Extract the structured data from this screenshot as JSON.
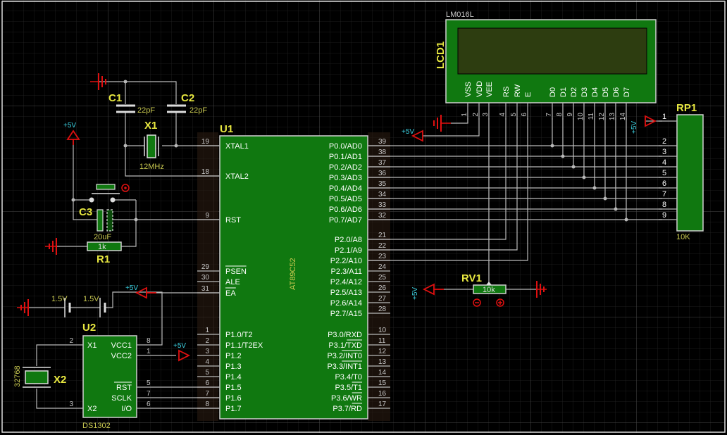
{
  "colors": {
    "background": "#000000",
    "grid": "#3a3a3a",
    "component_fill": "#107810",
    "wire": "#b9b9b9",
    "refdes": "#e8e840",
    "power_label": "#3bd0e0",
    "power_symbol": "#e01010"
  },
  "u1": {
    "ref": "U1",
    "part": "AT89C52",
    "left_pins": [
      {
        "num": "19",
        "name": "XTAL1"
      },
      {
        "num": "18",
        "name": "XTAL2"
      },
      {
        "num": "9",
        "name": "RST"
      },
      {
        "num": "29",
        "name": "PSEN"
      },
      {
        "num": "30",
        "name": "ALE"
      },
      {
        "num": "31",
        "name": "EA"
      },
      {
        "num": "1",
        "name": "P1.0/T2"
      },
      {
        "num": "2",
        "name": "P1.1/T2EX"
      },
      {
        "num": "3",
        "name": "P1.2"
      },
      {
        "num": "4",
        "name": "P1.3"
      },
      {
        "num": "5",
        "name": "P1.4"
      },
      {
        "num": "6",
        "name": "P1.5"
      },
      {
        "num": "7",
        "name": "P1.6"
      },
      {
        "num": "8",
        "name": "P1.7"
      }
    ],
    "right_pins": [
      {
        "num": "39",
        "name": "P0.0/AD0"
      },
      {
        "num": "38",
        "name": "P0.1/AD1"
      },
      {
        "num": "37",
        "name": "P0.2/AD2"
      },
      {
        "num": "36",
        "name": "P0.3/AD3"
      },
      {
        "num": "35",
        "name": "P0.4/AD4"
      },
      {
        "num": "34",
        "name": "P0.5/AD5"
      },
      {
        "num": "33",
        "name": "P0.6/AD6"
      },
      {
        "num": "32",
        "name": "P0.7/AD7"
      },
      {
        "num": "21",
        "name": "P2.0/A8"
      },
      {
        "num": "22",
        "name": "P2.1/A9"
      },
      {
        "num": "23",
        "name": "P2.2/A10"
      },
      {
        "num": "24",
        "name": "P2.3/A11"
      },
      {
        "num": "25",
        "name": "P2.4/A12"
      },
      {
        "num": "26",
        "name": "P2.5/A13"
      },
      {
        "num": "27",
        "name": "P2.6/A14"
      },
      {
        "num": "28",
        "name": "P2.7/A15"
      },
      {
        "num": "10",
        "name": "P3.0/RXD"
      },
      {
        "num": "11",
        "name": "P3.1/TXD"
      },
      {
        "num": "12",
        "name": "P3.2/INT0"
      },
      {
        "num": "13",
        "name": "P3.3/INT1"
      },
      {
        "num": "14",
        "name": "P3.4/T0"
      },
      {
        "num": "15",
        "name": "P3.5/T1"
      },
      {
        "num": "16",
        "name": "P3.6/WR"
      },
      {
        "num": "17",
        "name": "P3.7/RD"
      }
    ]
  },
  "lcd": {
    "ref": "LCD1",
    "part": "LM016L",
    "pins": [
      {
        "num": "1",
        "name": "VSS"
      },
      {
        "num": "2",
        "name": "VDD"
      },
      {
        "num": "3",
        "name": "VEE"
      },
      {
        "num": "4",
        "name": "RS"
      },
      {
        "num": "5",
        "name": "RW"
      },
      {
        "num": "6",
        "name": "E"
      },
      {
        "num": "7",
        "name": "D0"
      },
      {
        "num": "8",
        "name": "D1"
      },
      {
        "num": "9",
        "name": "D2"
      },
      {
        "num": "10",
        "name": "D3"
      },
      {
        "num": "11",
        "name": "D4"
      },
      {
        "num": "12",
        "name": "D5"
      },
      {
        "num": "13",
        "name": "D6"
      },
      {
        "num": "14",
        "name": "D7"
      }
    ]
  },
  "rp1": {
    "ref": "RP1",
    "value": "10K",
    "pins": [
      "1",
      "2",
      "3",
      "4",
      "5",
      "6",
      "7",
      "8",
      "9"
    ]
  },
  "u2": {
    "ref": "U2",
    "part": "DS1302",
    "left_pins": [
      {
        "num": "2",
        "name": "X1"
      },
      {
        "num": "3",
        "name": "X2"
      }
    ],
    "right_pins": [
      {
        "num": "8",
        "name": "VCC1"
      },
      {
        "num": "1",
        "name": "VCC2"
      },
      {
        "num": "5",
        "name": "RST"
      },
      {
        "num": "7",
        "name": "SCLK"
      },
      {
        "num": "6",
        "name": "I/O"
      }
    ]
  },
  "x1": {
    "ref": "X1",
    "value": "12MHz"
  },
  "x2": {
    "ref": "X2",
    "value": "32768"
  },
  "c1": {
    "ref": "C1",
    "value": "22pF"
  },
  "c2": {
    "ref": "C2",
    "value": "22pF"
  },
  "c3": {
    "ref": "C3",
    "value": "20uF"
  },
  "r1": {
    "ref": "R1",
    "value": "1k"
  },
  "rv1": {
    "ref": "RV1",
    "value": "10k"
  },
  "batteries": [
    {
      "value": "1.5V"
    },
    {
      "value": "1.5V"
    }
  ],
  "power": {
    "plus5v": "+5V"
  }
}
